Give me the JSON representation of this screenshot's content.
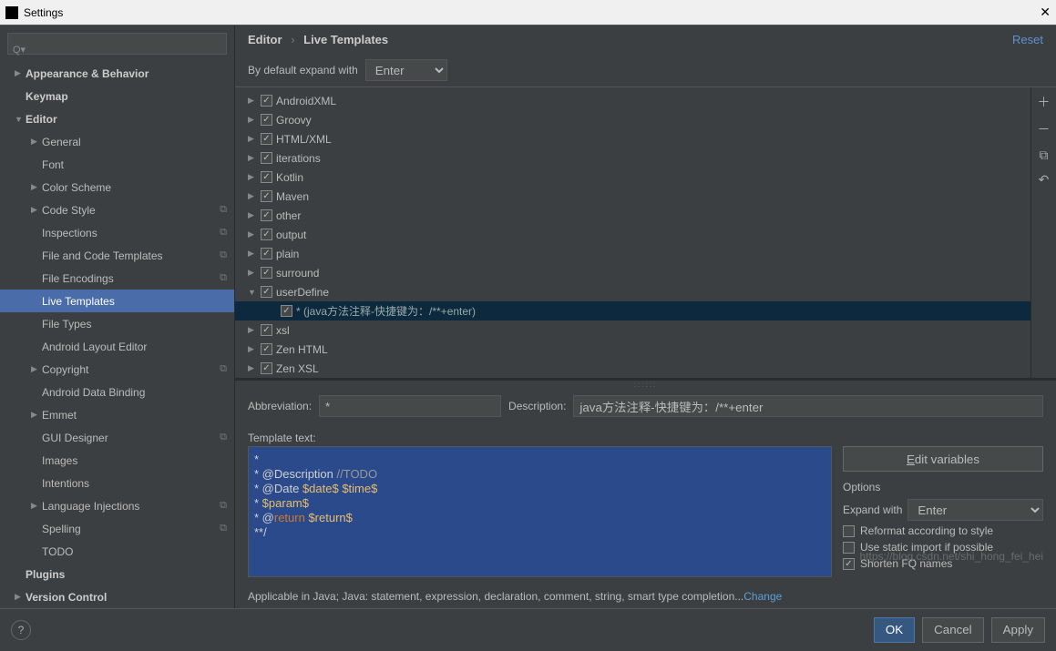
{
  "title": "Settings",
  "breadcrumb": {
    "a": "Editor",
    "b": "Live Templates",
    "reset": "Reset"
  },
  "expand": {
    "label": "By default expand with",
    "value": "Enter"
  },
  "sidebar": [
    {
      "lbl": "Appearance & Behavior",
      "bold": true,
      "arrow": "right",
      "indent": 0
    },
    {
      "lbl": "Keymap",
      "bold": true,
      "arrow": "",
      "indent": 0
    },
    {
      "lbl": "Editor",
      "bold": true,
      "arrow": "down",
      "indent": 0
    },
    {
      "lbl": "General",
      "arrow": "right",
      "indent": 1
    },
    {
      "lbl": "Font",
      "arrow": "",
      "indent": 1
    },
    {
      "lbl": "Color Scheme",
      "arrow": "right",
      "indent": 1
    },
    {
      "lbl": "Code Style",
      "arrow": "right",
      "indent": 1,
      "copy": true
    },
    {
      "lbl": "Inspections",
      "arrow": "",
      "indent": 1,
      "copy": true
    },
    {
      "lbl": "File and Code Templates",
      "arrow": "",
      "indent": 1,
      "copy": true
    },
    {
      "lbl": "File Encodings",
      "arrow": "",
      "indent": 1,
      "copy": true
    },
    {
      "lbl": "Live Templates",
      "arrow": "",
      "indent": 1,
      "sel": true
    },
    {
      "lbl": "File Types",
      "arrow": "",
      "indent": 1
    },
    {
      "lbl": "Android Layout Editor",
      "arrow": "",
      "indent": 1
    },
    {
      "lbl": "Copyright",
      "arrow": "right",
      "indent": 1,
      "copy": true
    },
    {
      "lbl": "Android Data Binding",
      "arrow": "",
      "indent": 1
    },
    {
      "lbl": "Emmet",
      "arrow": "right",
      "indent": 1
    },
    {
      "lbl": "GUI Designer",
      "arrow": "",
      "indent": 1,
      "copy": true
    },
    {
      "lbl": "Images",
      "arrow": "",
      "indent": 1
    },
    {
      "lbl": "Intentions",
      "arrow": "",
      "indent": 1
    },
    {
      "lbl": "Language Injections",
      "arrow": "right",
      "indent": 1,
      "copy": true
    },
    {
      "lbl": "Spelling",
      "arrow": "",
      "indent": 1,
      "copy": true
    },
    {
      "lbl": "TODO",
      "arrow": "",
      "indent": 1
    },
    {
      "lbl": "Plugins",
      "bold": true,
      "arrow": "",
      "indent": 0
    },
    {
      "lbl": "Version Control",
      "bold": true,
      "arrow": "right",
      "indent": 0
    }
  ],
  "templates": [
    {
      "lbl": "AndroidXML",
      "ar": "r",
      "chk": true
    },
    {
      "lbl": "Groovy",
      "ar": "r",
      "chk": true
    },
    {
      "lbl": "HTML/XML",
      "ar": "r",
      "chk": true
    },
    {
      "lbl": "iterations",
      "ar": "r",
      "chk": true
    },
    {
      "lbl": "Kotlin",
      "ar": "r",
      "chk": true
    },
    {
      "lbl": "Maven",
      "ar": "r",
      "chk": true
    },
    {
      "lbl": "other",
      "ar": "r",
      "chk": true
    },
    {
      "lbl": "output",
      "ar": "r",
      "chk": true
    },
    {
      "lbl": "plain",
      "ar": "r",
      "chk": true
    },
    {
      "lbl": "surround",
      "ar": "r",
      "chk": true
    },
    {
      "lbl": "userDefine",
      "ar": "d",
      "chk": true
    },
    {
      "lbl": "* (java方法注释-快捷键为：/**+enter)",
      "ar": "",
      "chk": true,
      "sel": true,
      "indent": 1
    },
    {
      "lbl": "xsl",
      "ar": "r",
      "chk": true
    },
    {
      "lbl": "Zen HTML",
      "ar": "r",
      "chk": true
    },
    {
      "lbl": "Zen XSL",
      "ar": "r",
      "chk": true
    }
  ],
  "abbr": {
    "label": "Abbreviation:",
    "value": "*"
  },
  "desc": {
    "label": "Description:",
    "value": "java方法注释-快捷键为：/**+enter"
  },
  "tmpltxt_lbl": "Template text:",
  "editvars": "Edit variables",
  "options": {
    "title": "Options",
    "expand_lbl": "Expand with",
    "expand_val": "Enter",
    "reformat": "Reformat according to style",
    "static": "Use static import if possible",
    "fq": "Shorten FQ names"
  },
  "applic": {
    "txt": "Applicable in Java; Java: statement, expression, declaration, comment, string, smart type completion...",
    "change": "Change"
  },
  "buttons": {
    "ok": "OK",
    "cancel": "Cancel",
    "apply": "Apply"
  },
  "watermark": "https://blog.csdn.net/shi_hong_fei_hei",
  "code": {
    "l1": " *",
    "l2a": " * @Description ",
    "l2b": "//TODO",
    "l3a": " * @Date ",
    "l3b": "$date$ $time$",
    "l4a": " * ",
    "l4b": "$param$",
    "l5a": " * @",
    "l5b": "return",
    "l5c": " $return$",
    "l6": " **/"
  }
}
